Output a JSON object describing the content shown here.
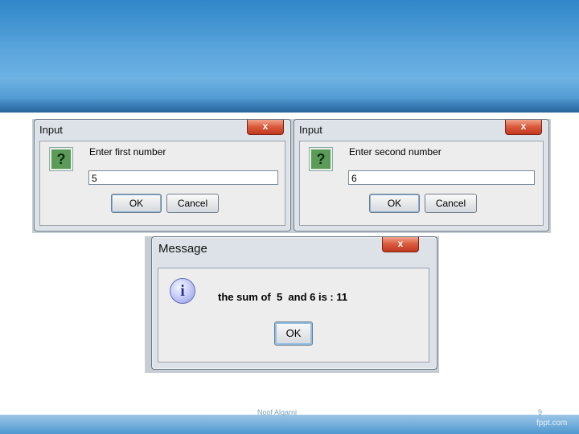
{
  "slide": {
    "author": "Noof Alqarni",
    "page_number": "9",
    "brand": "fppt.com"
  },
  "dialogs": {
    "input1": {
      "title": "Input",
      "close": "x",
      "icon": "question-icon",
      "prompt": "Enter first number",
      "value": "5",
      "ok": "OK",
      "cancel": "Cancel"
    },
    "input2": {
      "title": "Input",
      "close": "x",
      "icon": "question-icon",
      "prompt": "Enter second number",
      "value": "6",
      "ok": "OK",
      "cancel": "Cancel"
    },
    "message": {
      "title": "Message",
      "close": "x",
      "icon": "info-icon",
      "text": "the sum of  5  and 6 is : 11",
      "ok": "OK"
    }
  },
  "colors": {
    "header_blue": "#2f86c8",
    "dialog_frame": "#dde2e8",
    "close_red": "#c0391f",
    "question_green": "#5b9a58",
    "info_blue": "#8d98e0"
  }
}
